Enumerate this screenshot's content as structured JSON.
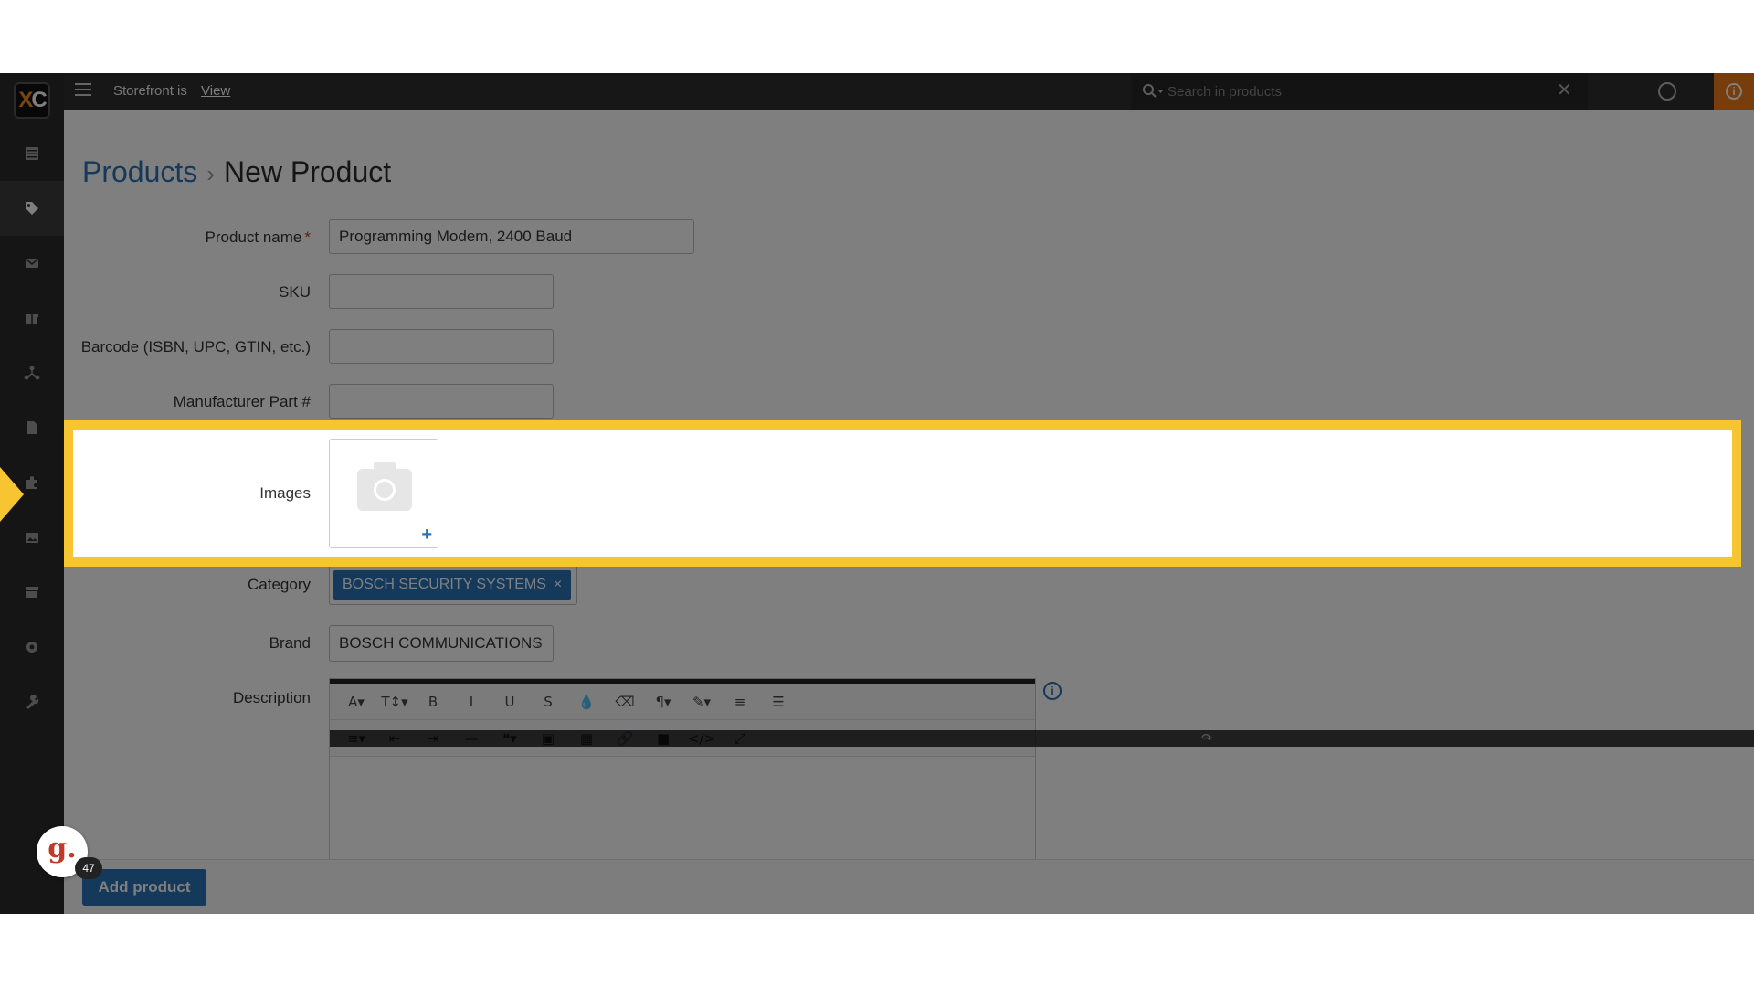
{
  "topbar": {
    "storefront_text": "Storefront is",
    "storefront_link": "View",
    "search_placeholder": "Search in products"
  },
  "logo": {
    "text_x": "X",
    "text_c": "C"
  },
  "breadcrumb": {
    "parent": "Products",
    "separator": "›",
    "current": "New Product"
  },
  "form": {
    "product_name_label": "Product name",
    "required_mark": "*",
    "product_name_value": "Programming Modem, 2400 Baud",
    "sku_label": "SKU",
    "sku_value": "",
    "barcode_label": "Barcode (ISBN, UPC, GTIN, etc.)",
    "barcode_value": "",
    "mpn_label": "Manufacturer Part #",
    "mpn_value": "",
    "images_label": "Images",
    "images_add": "+",
    "category_label": "Category",
    "category_tag": "BOSCH SECURITY SYSTEMS",
    "category_tag_remove": "×",
    "brand_label": "Brand",
    "brand_value": "BOSCH COMMUNICATIONS",
    "description_label": "Description"
  },
  "editor": {
    "row1": [
      "A▾",
      "T↕▾",
      "B",
      "I",
      "U",
      "S",
      "💧",
      "⌫",
      "¶▾",
      "✎▾",
      "≡",
      "☰"
    ],
    "row2": [
      "≡▾",
      "⇤",
      "⇥",
      "—",
      "❝▾",
      "▣",
      "▦",
      "🔗",
      "■",
      "↶",
      "↷",
      "</>",
      "⤢"
    ]
  },
  "actions": {
    "add_product": "Add product"
  },
  "grammarly": {
    "letter": "g.",
    "badge": "47"
  },
  "colors": {
    "accent": "#2b72b5",
    "highlight": "#f6c531",
    "brand_orange": "#f07a1a"
  }
}
